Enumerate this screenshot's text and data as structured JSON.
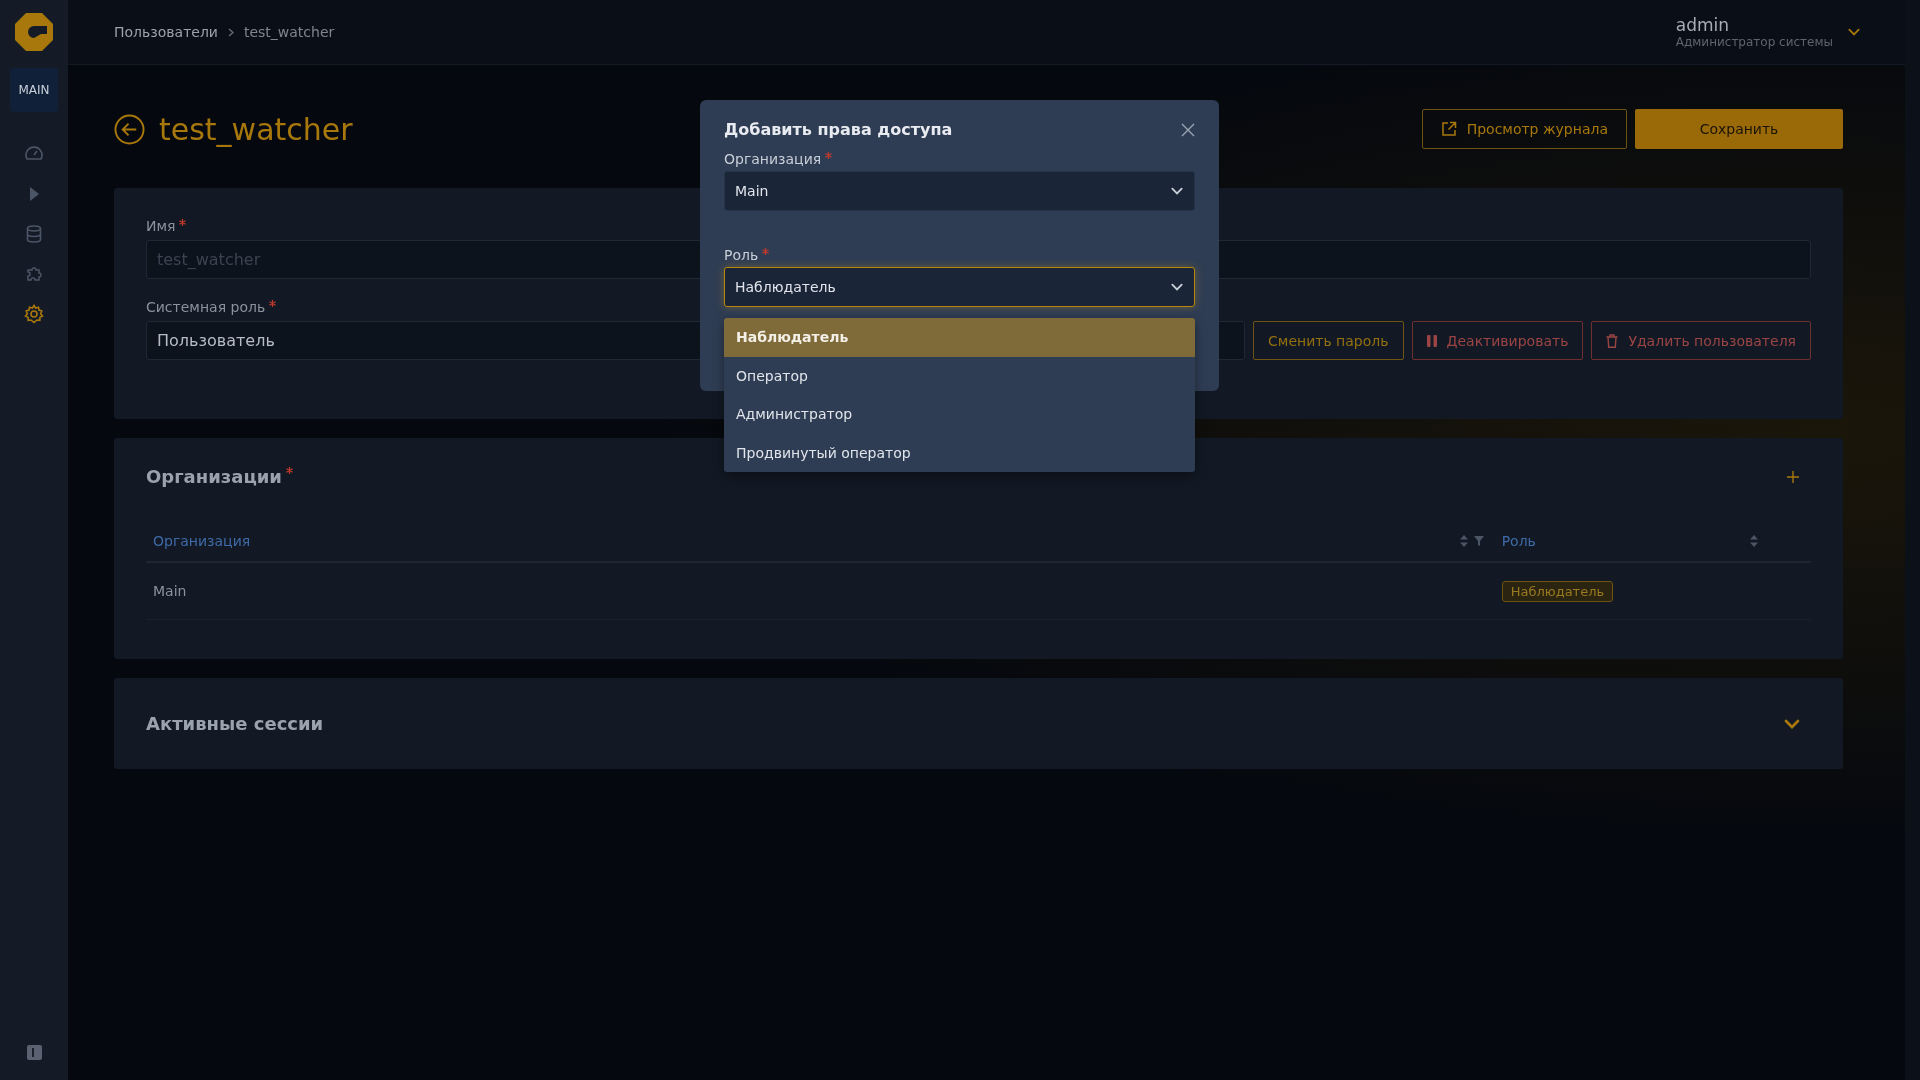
{
  "sidebar": {
    "workspace": "MAIN",
    "items": [
      {
        "kind": "dashboard",
        "selected": false
      },
      {
        "kind": "play",
        "selected": false
      },
      {
        "kind": "database",
        "selected": false
      },
      {
        "kind": "plugins",
        "selected": false
      },
      {
        "kind": "settings",
        "selected": true
      }
    ]
  },
  "header": {
    "breadcrumbs": [
      "Пользователи",
      "test_watcher"
    ],
    "user": {
      "name": "admin",
      "role": "Администратор системы"
    }
  },
  "page": {
    "title": "test_watcher",
    "actions": [
      {
        "label": "Просмотр журнала",
        "kind": "outline"
      },
      {
        "label": "Сохранить",
        "kind": "primary"
      }
    ]
  },
  "user_form": {
    "fields": [
      {
        "label": "Имя",
        "required": true,
        "value": "test_watcher",
        "disabled": true
      },
      {
        "label": "Системная роль",
        "required": true,
        "value": "Пользователь",
        "disabled": false
      }
    ],
    "buttons": [
      {
        "label": "Сменить пароль",
        "kind": "warning"
      },
      {
        "label": "Деактивировать",
        "kind": "deactivate"
      },
      {
        "label": "Удалить пользователя",
        "kind": "delete"
      }
    ]
  },
  "organizations": {
    "title": "Организации",
    "required": true,
    "columns": [
      {
        "label": "Организация",
        "filter": true
      },
      {
        "label": "Роль",
        "filter": false
      }
    ],
    "rows": [
      {
        "organization": "Main",
        "role": "Наблюдатель"
      }
    ]
  },
  "sessions": {
    "title": "Активные сессии",
    "expanded": false
  },
  "dialog": {
    "title": "Добавить права доступа",
    "fields": [
      {
        "label": "Организация",
        "required": true,
        "value": "Main",
        "focused": false
      },
      {
        "label": "Роль",
        "required": true,
        "value": "Наблюдатель",
        "focused": true
      }
    ],
    "options": [
      {
        "label": "Наблюдатель",
        "selected": true
      },
      {
        "label": "Оператор",
        "selected": false
      },
      {
        "label": "Администратор",
        "selected": false
      },
      {
        "label": "Продвинутый оператор",
        "selected": false
      }
    ]
  }
}
